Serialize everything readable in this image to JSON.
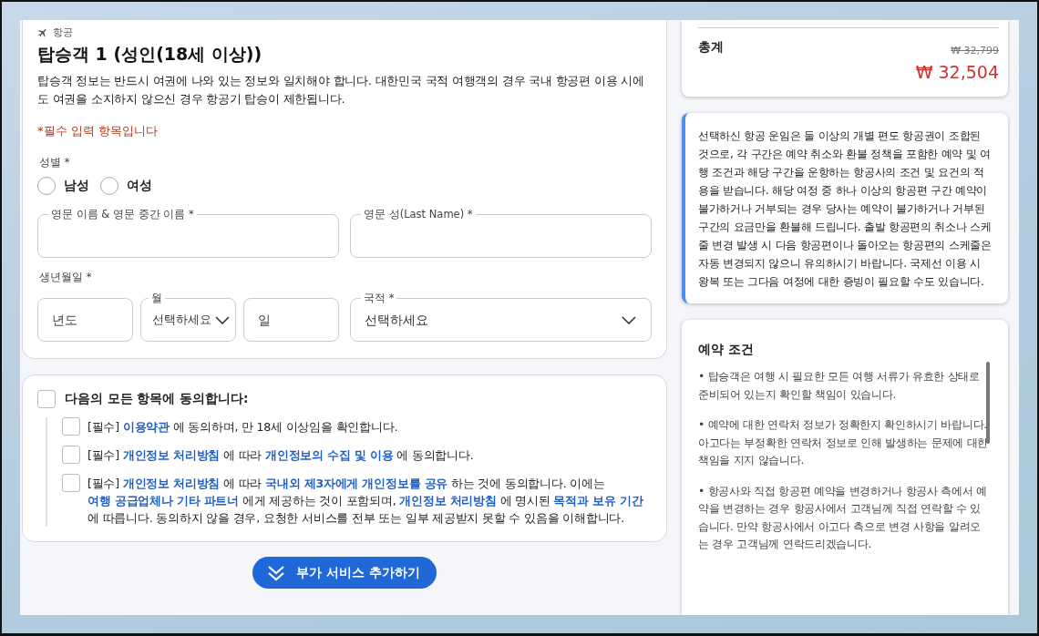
{
  "passenger_form": {
    "category": "항공",
    "title": "탑승객 1 (성인(18세 이상))",
    "notice": "탑승객 정보는 반드시 여권에 나와 있는 정보와 일치해야 합니다. 대한민국 국적 여행객의 경우 국내 항공편 이용 시에도 여권을 소지하지 않으신 경우 항공기 탑승이 제한됩니다.",
    "required_note": "*필수 입력 항목입니다",
    "gender": {
      "label": "성별 *",
      "options": [
        {
          "label": "남성",
          "selected": false
        },
        {
          "label": "여성",
          "selected": false
        }
      ]
    },
    "name_fields": [
      {
        "label": "영문 이름 & 영문 중간 이름 *"
      },
      {
        "label": "영문 성(Last Name) *"
      }
    ],
    "birth_label": "생년월일 *",
    "birth_fields": [
      {
        "kind": "input",
        "placeholder": "년도"
      },
      {
        "kind": "select",
        "label": "월",
        "value": "선택하세요"
      },
      {
        "kind": "input",
        "placeholder": "일"
      }
    ],
    "nationality": {
      "kind": "select",
      "label": "국적 *",
      "value": "선택하세요"
    }
  },
  "agreements": {
    "all": {
      "label": "다음의 모든 항목에 동의합니다:",
      "checked": false
    },
    "items": [
      {
        "text": "[필수] **이용약관** 에 동의하며, 만 18세 이상임을 확인합니다.",
        "checked": false
      },
      {
        "text": "[필수] **개인정보 처리방침** 에 따라 **개인정보의 수집 및 이용** 에 동의합니다.",
        "checked": false
      },
      {
        "text": "[필수] **개인정보 처리방침** 에 따라 **국내외 제3자에게 개인정보를 공유** 하는 것에 동의합니다. 이에는 **여행 공급업체나 기타 파트너** 에게 제공하는 것이 포함되며, **개인정보 처리방침** 에 명시된 **목적과 보유 기간** 에 따릅니다. 동의하지 않을 경우, 요청한 서비스를 전부 또는 일부 제공받지 못할 수 있음을 이해합니다.",
        "checked": false
      }
    ]
  },
  "add_services_button": "부가 서비스 추가하기",
  "price_summary": {
    "label": "총계",
    "original_price": "₩ 32,799",
    "total": "₩ 32,504"
  },
  "fare_notice": "선택하신 항공 운임은 둘 이상의 개별 편도 항공권이 조합된 것으로, 각 구간은 예약 취소와 환불 정책을 포함한 예약 및 여행 조건과 해당 구간을 운항하는 항공사의 조건 및 요건의 적용을 받습니다. 해당 여정 중 하나 이상의 항공편 구간 예약이 불가하거나 거부되는 경우 당사는 예약이 불가하거나 거부된 구간의 요금만을 환불해 드립니다. 출발 항공편의 취소나 스케줄 변경 발생 시 다음 항공편이나 돌아오는 항공편의 스케줄은 자동 변경되지 않으니 유의하시기 바랍니다. 국제선 이용 시 왕복 또는 그다음 여정에 대한 증빙이 필요할 수도 있습니다.",
  "booking_terms": {
    "title": "예약 조건",
    "items": [
      "• 탑승객은 여행 시 필요한 모든 여행 서류가 유효한 상태로 준비되어 있는지 확인할 책임이 있습니다.",
      "• 예약에 대한 연락처 정보가 정확한지 확인하시기 바랍니다. 아고다는 부정확한 연락처 정보로 인해 발생하는 문제에 대한 책임을 지지 않습니다.",
      "• 항공사와 직접 항공편 예약을 변경하거나 항공사 측에서 예약을 변경하는 경우 항공사에서 고객님께 직접 연락할 수 있습니다. 만약 항공사에서 아고다 측으로 변경 사항을 알려오는 경우 고객님께 연락드리겠습니다."
    ]
  }
}
